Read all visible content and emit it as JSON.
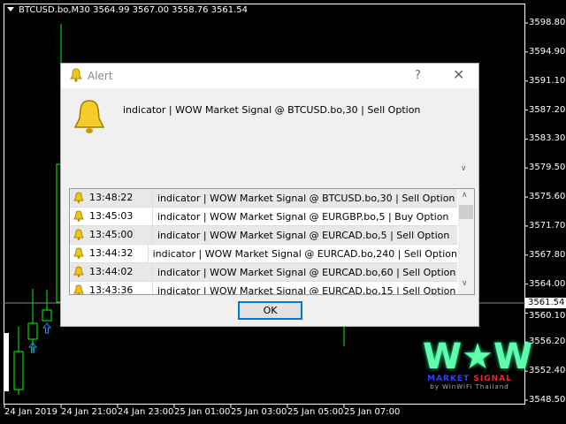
{
  "chart": {
    "symbol_line": "BTCUSD.bo,M30  3564.99 3567.00 3558.76 3561.54",
    "current_price": "3561.54",
    "price_labels": [
      "3598.80",
      "3594.90",
      "3591.10",
      "3587.20",
      "3583.30",
      "3579.50",
      "3575.60",
      "3571.70",
      "3567.80",
      "3564.00",
      "3560.10",
      "3556.20",
      "3552.40",
      "3548.50"
    ],
    "time_labels": [
      "24 Jan 2019",
      "24 Jan 21:00",
      "24 Jan 23:00",
      "25 Jan 01:00",
      "25 Jan 03:00",
      "25 Jan 05:00",
      "25 Jan 07:00"
    ],
    "bull_color": "#00ff00",
    "arrow_color": "#1e90ff"
  },
  "dialog": {
    "title": "Alert",
    "help": "?",
    "close": "✕",
    "message": "indicator | WOW Market Signal @ BTCUSD.bo,30 | Sell Option",
    "alerts": [
      {
        "time": "13:48:22",
        "message": "indicator | WOW Market Signal @ BTCUSD.bo,30 | Sell Option"
      },
      {
        "time": "13:45:03",
        "message": "indicator | WOW Market Signal @ EURGBP.bo,5 | Buy Option"
      },
      {
        "time": "13:45:00",
        "message": "indicator | WOW Market Signal @ EURCAD.bo,5 | Sell Option"
      },
      {
        "time": "13:44:32",
        "message": "indicator | WOW Market Signal @ EURCAD.bo,240 | Sell Option"
      },
      {
        "time": "13:44:02",
        "message": "indicator | WOW Market Signal @ EURCAD.bo,60 | Sell Option"
      },
      {
        "time": "13:43:36",
        "message": "indicator | WOW Market Signal @ EURCAD.bo,15 | Sell Option"
      }
    ],
    "ok_label": "OK"
  },
  "logo": {
    "big": "W★W",
    "line1a": "MARKET",
    "line1b": "SIGNAL",
    "line2": "by WinWiFi Thailand"
  }
}
